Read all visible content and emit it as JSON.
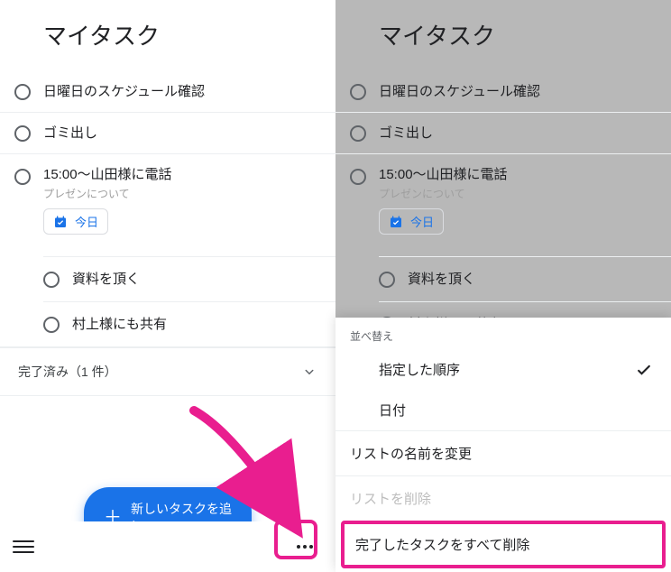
{
  "left": {
    "title": "マイタスク",
    "tasks": {
      "t1": "日曜日のスケジュール確認",
      "t2": "ゴミ出し",
      "t3": {
        "title": "15:00〜山田様に電話",
        "note": "プレゼンについて",
        "chip": "今日"
      },
      "subs": {
        "s1": "資料を頂く",
        "s2": "村上様にも共有"
      }
    },
    "completed_label": "完了済み（1 件）",
    "fab": "新しいタスクを追加"
  },
  "right": {
    "title": "マイタスク",
    "tasks": {
      "t1": "日曜日のスケジュール確認",
      "t2": "ゴミ出し",
      "t3": {
        "title": "15:00〜山田様に電話",
        "note": "プレゼンについて",
        "chip": "今日"
      },
      "subs": {
        "s1": "資料を頂く",
        "s2": "村上様にも共有"
      }
    },
    "sheet": {
      "sort_label": "並べ替え",
      "sort_custom": "指定した順序",
      "sort_date": "日付",
      "rename": "リストの名前を変更",
      "delete_list": "リストを削除",
      "delete_completed": "完了したタスクをすべて削除"
    }
  }
}
